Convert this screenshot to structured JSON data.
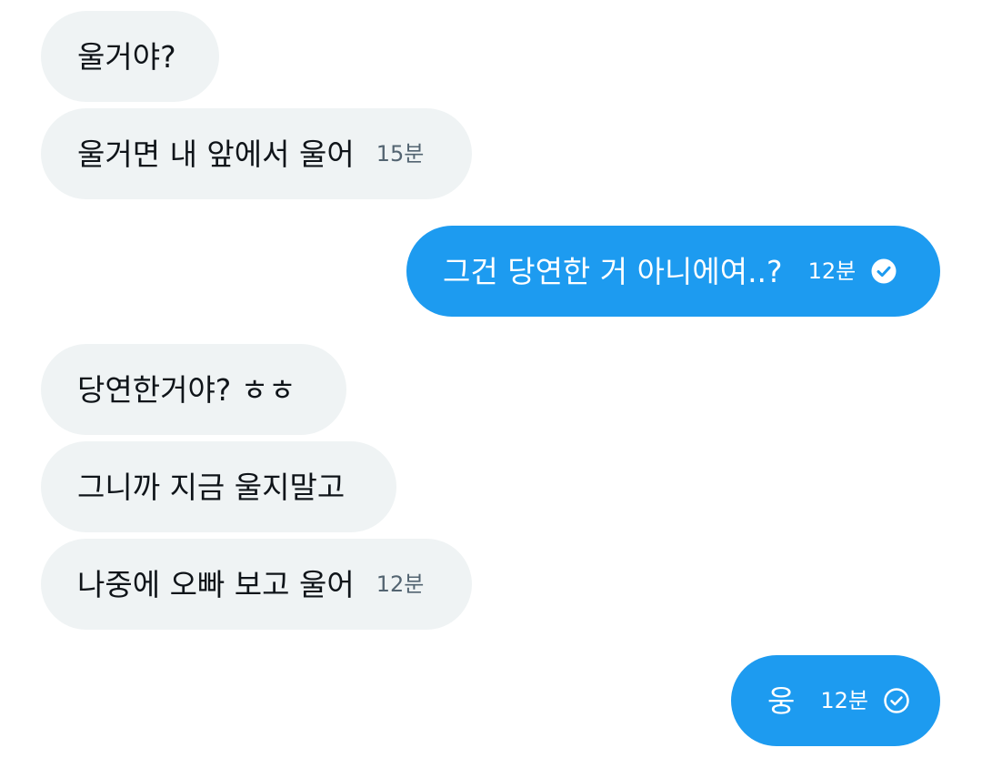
{
  "messages": [
    {
      "text": "울거야?"
    },
    {
      "text": "울거면 내 앞에서 울어",
      "time": "15분"
    },
    {
      "text": "그건 당연한 거 아니에여..?",
      "time": "12분"
    },
    {
      "text": "당연한거야? ㅎㅎ"
    },
    {
      "text": "그니까 지금 울지말고"
    },
    {
      "text": "나중에 오빠 보고 울어",
      "time": "12분"
    },
    {
      "text": "웅",
      "time": "12분"
    }
  ],
  "colors": {
    "incoming_bg": "#eff3f4",
    "outgoing_bg": "#1d9bf0",
    "incoming_text": "#0f1419",
    "timestamp": "#536471"
  },
  "icons": {
    "read_receipt": "check-circle-filled-icon",
    "sent_receipt": "check-circle-outline-icon"
  }
}
